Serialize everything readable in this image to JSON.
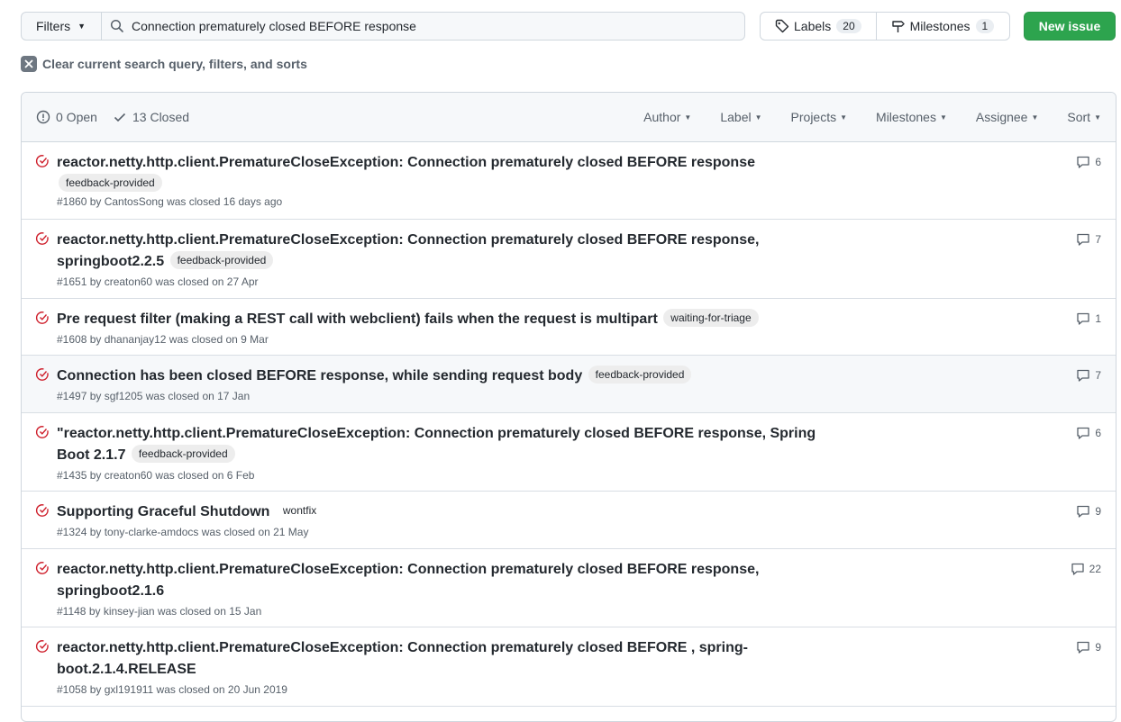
{
  "toolbar": {
    "filters_label": "Filters",
    "search_value": "Connection prematurely closed BEFORE response",
    "labels_label": "Labels",
    "labels_count": "20",
    "milestones_label": "Milestones",
    "milestones_count": "1",
    "new_issue_label": "New issue"
  },
  "clear_filters": "Clear current search query, filters, and sorts",
  "header": {
    "open_label": "0 Open",
    "closed_label": "13 Closed",
    "menus": [
      "Author",
      "Label",
      "Projects",
      "Milestones",
      "Assignee",
      "Sort"
    ]
  },
  "colors": {
    "accent_green": "#2da44e",
    "closed_red": "#cf222e",
    "muted": "#57606a"
  },
  "issues": [
    {
      "title_before": "reactor.netty.http.client.PrematureCloseException: Connection prematurely closed BEFORE response",
      "label": "feedback-provided",
      "meta": "#1860 by CantosSong was closed 16 days ago",
      "comments": "6"
    },
    {
      "title_before": "reactor.netty.http.client.PrematureCloseException: Connection prematurely closed BEFORE response, springboot2.2.5",
      "label": "feedback-provided",
      "meta": "#1651 by creaton60 was closed on 27 Apr",
      "comments": "7"
    },
    {
      "title_before": "Pre request filter (making a REST call with webclient) fails when the request is multipart",
      "label": "waiting-for-triage",
      "meta": "#1608 by dhananjay12 was closed on 9 Mar",
      "comments": "1"
    },
    {
      "title_before": "Connection has been closed BEFORE response, while sending request body",
      "label": "feedback-provided",
      "meta": "#1497 by sgf1205 was closed on 17 Jan",
      "comments": "7"
    },
    {
      "title_before": "\"reactor.netty.http.client.PrematureCloseException: Connection prematurely closed BEFORE response, Spring Boot 2.1.7",
      "label": "feedback-provided",
      "meta": "#1435 by creaton60 was closed on 6 Feb",
      "comments": "6"
    },
    {
      "title_before": "Supporting Graceful Shutdown",
      "label": "wontfix",
      "meta": "#1324 by tony-clarke-amdocs was closed on 21 May",
      "comments": "9"
    },
    {
      "title_before": "reactor.netty.http.client.PrematureCloseException: Connection prematurely closed BEFORE response, springboot2.1.6",
      "label": "",
      "meta": "#1148 by kinsey-jian was closed on 15 Jan",
      "comments": "22"
    },
    {
      "title_before": "reactor.netty.http.client.PrematureCloseException: Connection prematurely closed BEFORE , spring-boot.2.1.4.RELEASE",
      "label": "",
      "meta": "#1058 by gxl191911 was closed on 20 Jun 2019",
      "comments": "9"
    }
  ]
}
